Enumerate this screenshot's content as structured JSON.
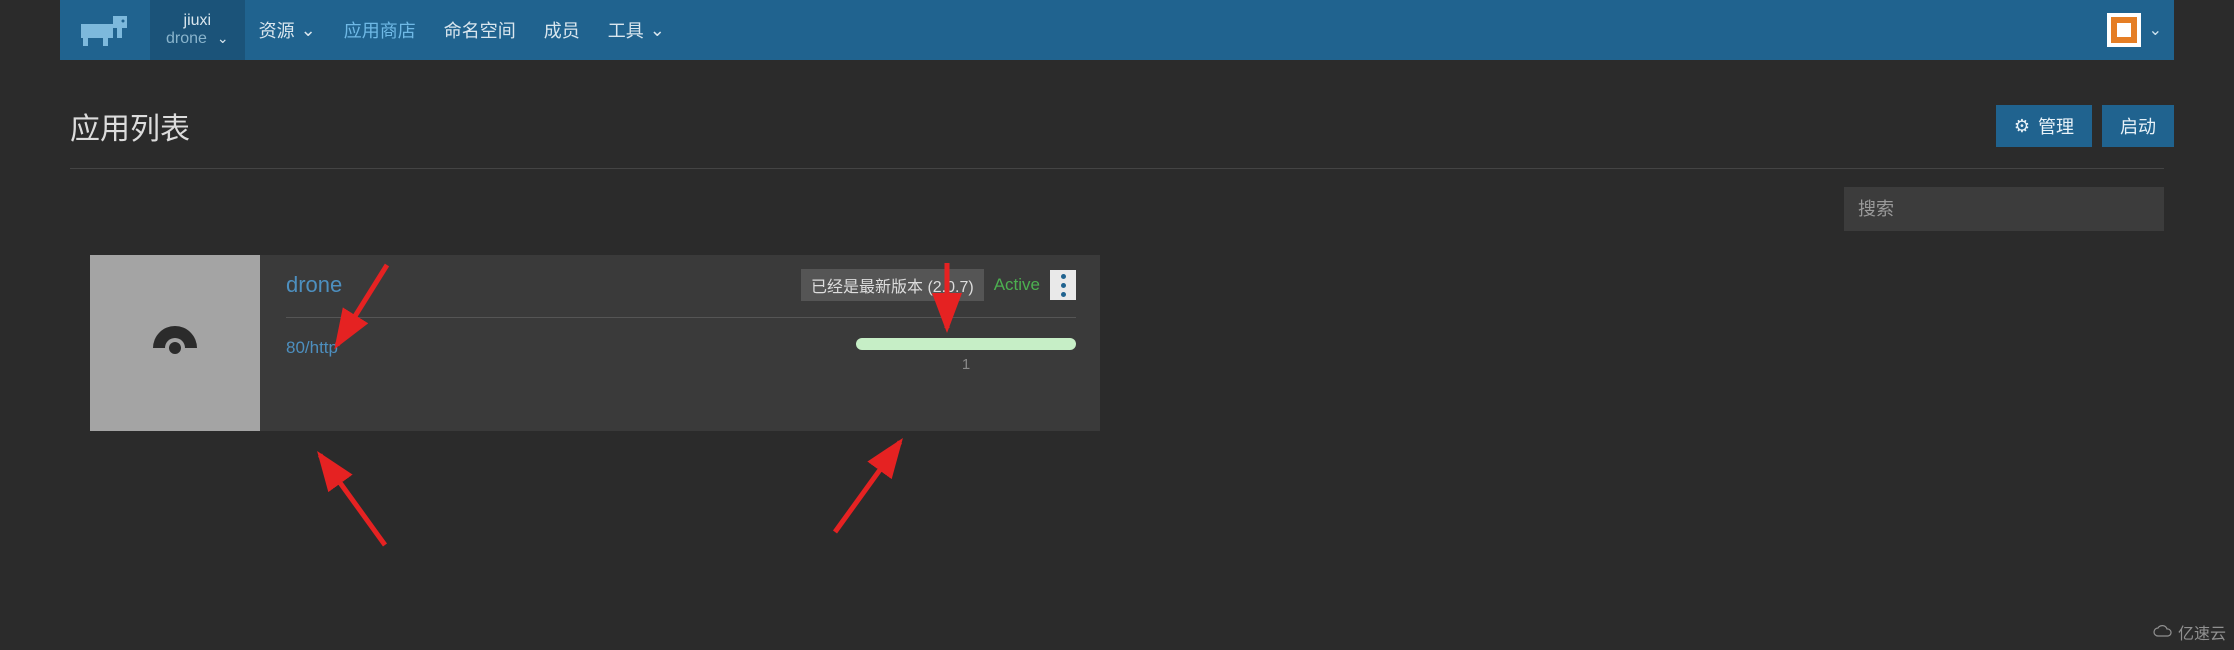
{
  "header": {
    "env_top": "jiuxi",
    "env_bottom": "drone",
    "nav": [
      {
        "label": "资源",
        "caret": true
      },
      {
        "label": "应用商店",
        "accent": true
      },
      {
        "label": "命名空间"
      },
      {
        "label": "成员"
      },
      {
        "label": "工具",
        "caret": true
      }
    ]
  },
  "page": {
    "title": "应用列表",
    "manage_btn": "管理",
    "launch_btn": "启动",
    "search_placeholder": "搜索"
  },
  "app": {
    "name": "drone",
    "version_badge": "已经是最新版本 (2.0.7)",
    "status": "Active",
    "port": "80/http",
    "replica_count": "1",
    "icon": "drone-logo-icon"
  },
  "watermark": "亿速云"
}
